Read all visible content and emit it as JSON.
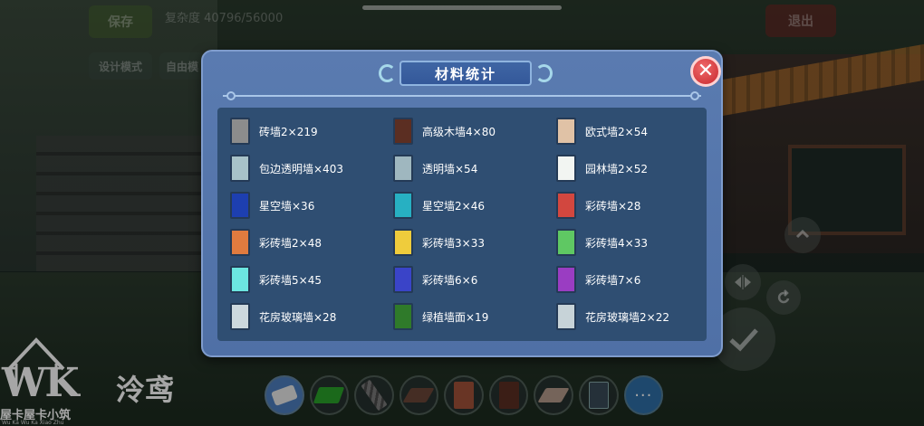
{
  "hud": {
    "save_label": "保存",
    "capacity_label": "复杂度 40796/56000",
    "exit_label": "退出",
    "design_mode_label": "设计模式",
    "free_label": "自由模"
  },
  "controls": {
    "up_icon": "chevron-up-icon",
    "mirror_icon": "mirror-icon",
    "rotate_icon": "rotate-icon",
    "confirm_icon": "checkmark-icon"
  },
  "modal": {
    "title": "材料统计",
    "close_glyph": "✕",
    "materials": [
      {
        "label": "砖墙2×219",
        "color": "#8c8c8c"
      },
      {
        "label": "高级木墙4×80",
        "color": "#5b2e22"
      },
      {
        "label": "欧式墙2×54",
        "color": "#e0c2a6"
      },
      {
        "label": "包边透明墙×403",
        "color": "#a8c2c8"
      },
      {
        "label": "透明墙×54",
        "color": "#9fb7bf"
      },
      {
        "label": "园林墙2×52",
        "color": "#f2f5f2"
      },
      {
        "label": "星空墙×36",
        "color": "#1d3fb0"
      },
      {
        "label": "星空墙2×46",
        "color": "#27b0c2"
      },
      {
        "label": "彩砖墙×28",
        "color": "#d2473f"
      },
      {
        "label": "彩砖墙2×48",
        "color": "#e07b3f"
      },
      {
        "label": "彩砖墙3×33",
        "color": "#efcc3c"
      },
      {
        "label": "彩砖墙4×33",
        "color": "#5fc863"
      },
      {
        "label": "彩砖墙5×45",
        "color": "#6ce6e0"
      },
      {
        "label": "彩砖墙6×6",
        "color": "#3a44c8"
      },
      {
        "label": "彩砖墙7×6",
        "color": "#9a3dc2"
      },
      {
        "label": "花房玻璃墙×28",
        "color": "#cdd8dd"
      },
      {
        "label": "绿植墙面×19",
        "color": "#2f7a2a"
      },
      {
        "label": "花房玻璃墙2×22",
        "color": "#c7d3d8"
      }
    ]
  },
  "toolbar": {
    "slots": [
      {
        "name": "eraser-tool",
        "color": "#e8e8e8"
      },
      {
        "name": "grass-block",
        "color": "#2aa22a"
      },
      {
        "name": "stairs-block",
        "color": "#6b6b6b"
      },
      {
        "name": "wood-floor-block",
        "color": "#6a4638"
      },
      {
        "name": "brick-wall-block",
        "color": "#a2523a"
      },
      {
        "name": "dark-wood-block",
        "color": "#5b2e22"
      },
      {
        "name": "tile-floor-block",
        "color": "#b49a8a"
      },
      {
        "name": "glass-wall-block",
        "color": "#3a4a58"
      }
    ],
    "more_label": "···"
  },
  "watermark": {
    "logo_text": "WK",
    "sub_text": "屋卡屋卡小筑",
    "tiny_text": "Wu Ka Wu Ka Xiao Zhu",
    "author": "泠鸢"
  }
}
